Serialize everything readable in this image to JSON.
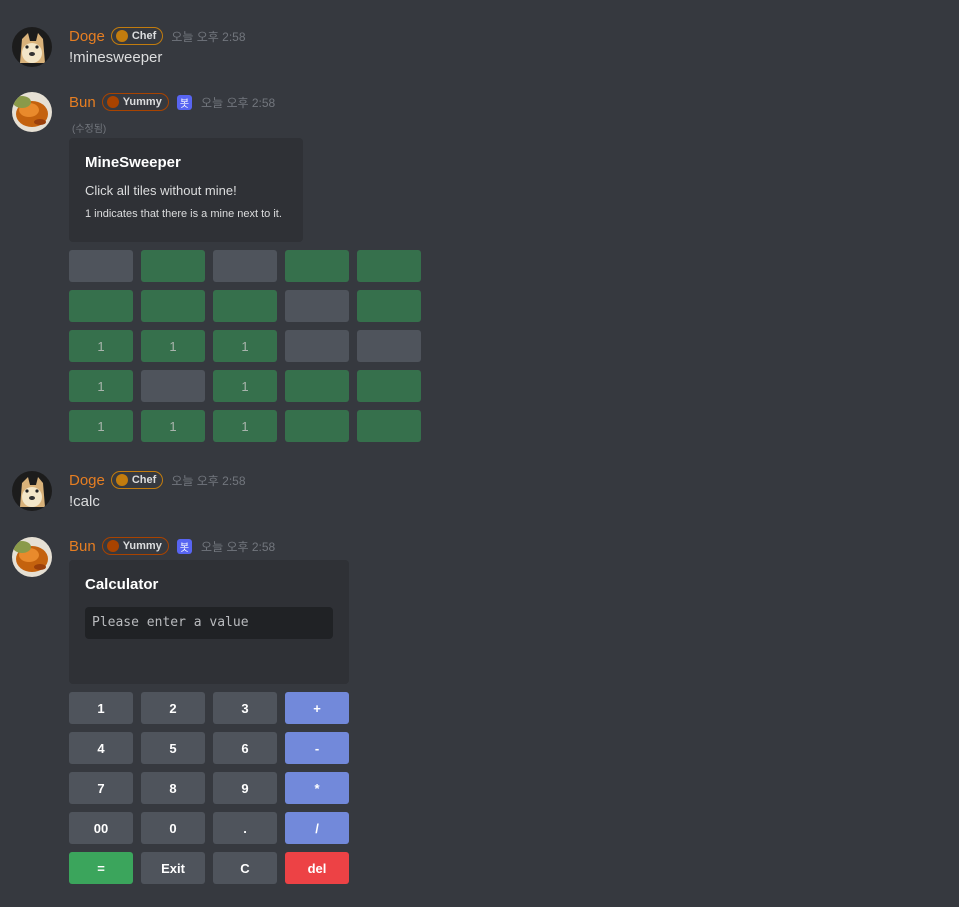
{
  "users": {
    "doge": {
      "name": "Doge",
      "color": "#e67e22",
      "role": "Chef",
      "role_dot": "#c27c0e"
    },
    "bun": {
      "name": "Bun",
      "color": "#e67e22",
      "role": "Yummy",
      "role_dot": "#a84300",
      "bot_tag": "봇"
    }
  },
  "messages": [
    {
      "author": "Doge",
      "role": "Chef",
      "time": "오늘 오후 2:58",
      "text": "!minesweeper"
    },
    {
      "author": "Bun",
      "role": "Yummy",
      "bot": "봇",
      "time": "오늘 오후 2:58",
      "edited": "(수정됨)",
      "embed": {
        "title": "MineSweeper",
        "description": "Click all tiles without mine!",
        "note": "1 indicates that there is a mine next to it."
      }
    },
    {
      "author": "Doge",
      "role": "Chef",
      "time": "오늘 오후 2:58",
      "text": "!calc"
    },
    {
      "author": "Bun",
      "role": "Yummy",
      "bot": "봇",
      "time": "오늘 오후 2:58",
      "embed": {
        "title": "Calculator",
        "display": "Please enter a value"
      }
    }
  ],
  "minesweeper": [
    [
      {
        "label": "",
        "state": "gray"
      },
      {
        "label": "",
        "state": "green"
      },
      {
        "label": "",
        "state": "gray"
      },
      {
        "label": "",
        "state": "green"
      },
      {
        "label": "",
        "state": "green"
      }
    ],
    [
      {
        "label": "",
        "state": "green"
      },
      {
        "label": "",
        "state": "green"
      },
      {
        "label": "",
        "state": "green"
      },
      {
        "label": "",
        "state": "gray"
      },
      {
        "label": "",
        "state": "green"
      }
    ],
    [
      {
        "label": "1",
        "state": "green"
      },
      {
        "label": "1",
        "state": "green"
      },
      {
        "label": "1",
        "state": "green"
      },
      {
        "label": "",
        "state": "gray"
      },
      {
        "label": "",
        "state": "gray"
      }
    ],
    [
      {
        "label": "1",
        "state": "green"
      },
      {
        "label": "",
        "state": "gray"
      },
      {
        "label": "1",
        "state": "green"
      },
      {
        "label": "",
        "state": "green"
      },
      {
        "label": "",
        "state": "green"
      }
    ],
    [
      {
        "label": "1",
        "state": "green"
      },
      {
        "label": "1",
        "state": "green"
      },
      {
        "label": "1",
        "state": "green"
      },
      {
        "label": "",
        "state": "green"
      },
      {
        "label": "",
        "state": "green"
      }
    ]
  ],
  "calculator": [
    [
      {
        "label": "1",
        "style": "gray"
      },
      {
        "label": "2",
        "style": "gray"
      },
      {
        "label": "3",
        "style": "gray"
      },
      {
        "label": "+",
        "style": "blurple"
      }
    ],
    [
      {
        "label": "4",
        "style": "gray"
      },
      {
        "label": "5",
        "style": "gray"
      },
      {
        "label": "6",
        "style": "gray"
      },
      {
        "label": "-",
        "style": "blurple"
      }
    ],
    [
      {
        "label": "7",
        "style": "gray"
      },
      {
        "label": "8",
        "style": "gray"
      },
      {
        "label": "9",
        "style": "gray"
      },
      {
        "label": "*",
        "style": "blurple"
      }
    ],
    [
      {
        "label": "00",
        "style": "gray"
      },
      {
        "label": "0",
        "style": "gray"
      },
      {
        "label": ".",
        "style": "gray"
      },
      {
        "label": "/",
        "style": "blurple"
      }
    ],
    [
      {
        "label": "=",
        "style": "green"
      },
      {
        "label": "Exit",
        "style": "gray"
      },
      {
        "label": "C",
        "style": "gray"
      },
      {
        "label": "del",
        "style": "red"
      }
    ]
  ]
}
